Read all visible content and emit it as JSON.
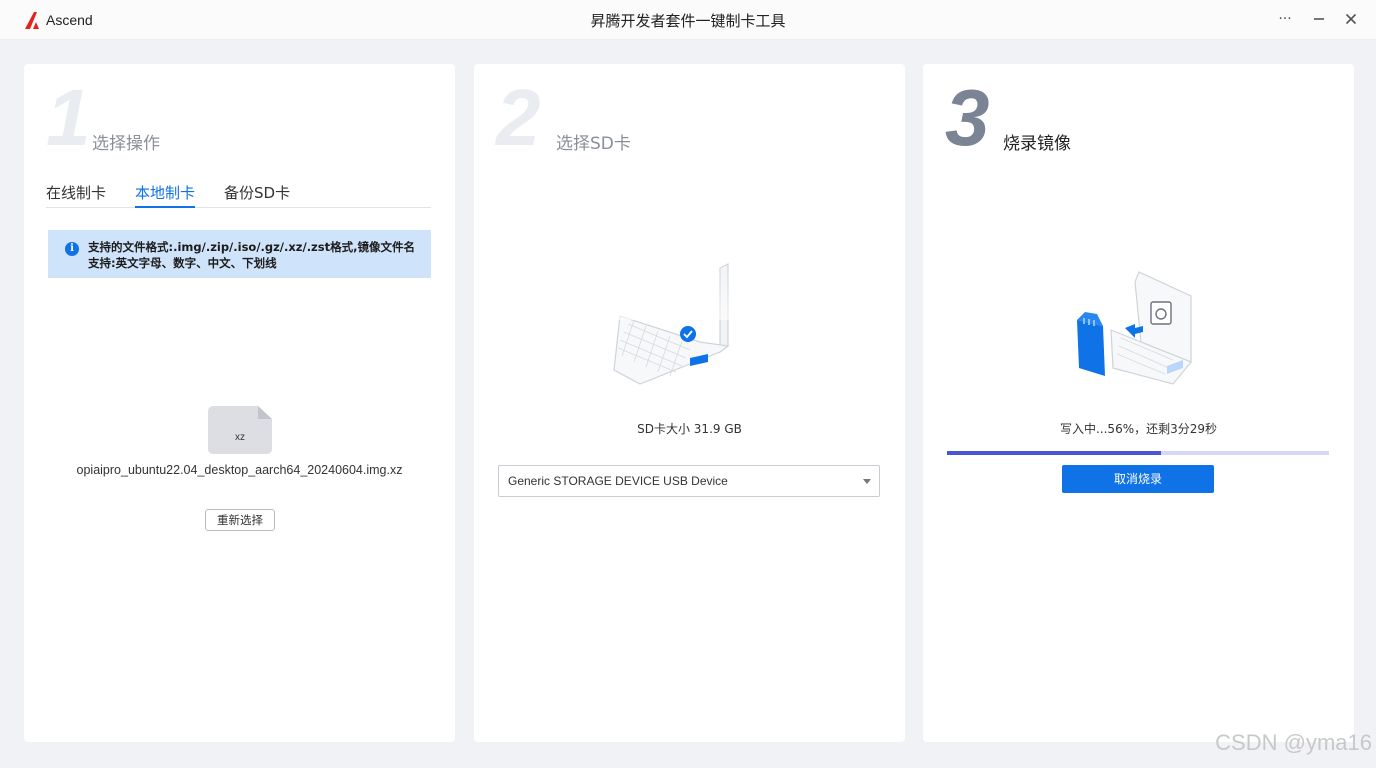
{
  "window": {
    "logo_text": "Ascend",
    "title": "昇腾开发者套件一键制卡工具",
    "menu_icon": "more-dots-icon",
    "minimize_icon": "minimize-icon",
    "close_icon": "close-icon"
  },
  "step1": {
    "number": "1",
    "title": "选择操作",
    "tabs": [
      {
        "label": "在线制卡",
        "active": false
      },
      {
        "label": "本地制卡",
        "active": true
      },
      {
        "label": "备份SD卡",
        "active": false
      }
    ],
    "info_text": "支持的文件格式:.img/.zip/.iso/.gz/.xz/.zst格式,镜像文件名支持:英文字母、数字、中文、下划线",
    "file_ext": "xz",
    "file_name": "opiaipro_ubuntu22.04_desktop_aarch64_20240604.img.xz",
    "reselect_label": "重新选择"
  },
  "step2": {
    "number": "2",
    "title": "选择SD卡",
    "sd_size": "SD卡大小  31.9  GB",
    "device": "Generic  STORAGE  DEVICE  USB  Device"
  },
  "step3": {
    "number": "3",
    "title": "烧录镜像",
    "progress_text": "写入中...56%，还剩3分29秒",
    "progress": 0.56,
    "cancel_label": "取消烧录"
  },
  "colors": {
    "accent": "#0f72e6",
    "progress": "#4a55d6",
    "step_inactive": "#e9ecf1",
    "step_active": "#7b8495"
  },
  "watermark": "CSDN @yma16"
}
